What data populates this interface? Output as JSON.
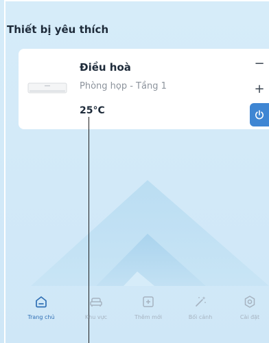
{
  "section": {
    "title": "Thiết bị yêu thích"
  },
  "device": {
    "name": "Điều hoà",
    "location": "Phòng họp - Tầng 1",
    "temperature": "25°C",
    "minus_label": "−",
    "plus_label": "+",
    "power_icon": "power-icon"
  },
  "nav": {
    "items": [
      {
        "label": "Trang chủ",
        "icon": "home-icon",
        "active": true
      },
      {
        "label": "Khu vực",
        "icon": "sofa-icon",
        "active": false
      },
      {
        "label": "Thêm mới",
        "icon": "plus-square-icon",
        "active": false
      },
      {
        "label": "Bối cảnh",
        "icon": "magic-wand-icon",
        "active": false
      },
      {
        "label": "Cài đặt",
        "icon": "settings-icon",
        "active": false
      }
    ]
  },
  "colors": {
    "accent": "#3f86d3",
    "nav_active": "#2f6fb4",
    "nav_inactive": "#a6b3c0",
    "background": "#d3eaf8"
  }
}
